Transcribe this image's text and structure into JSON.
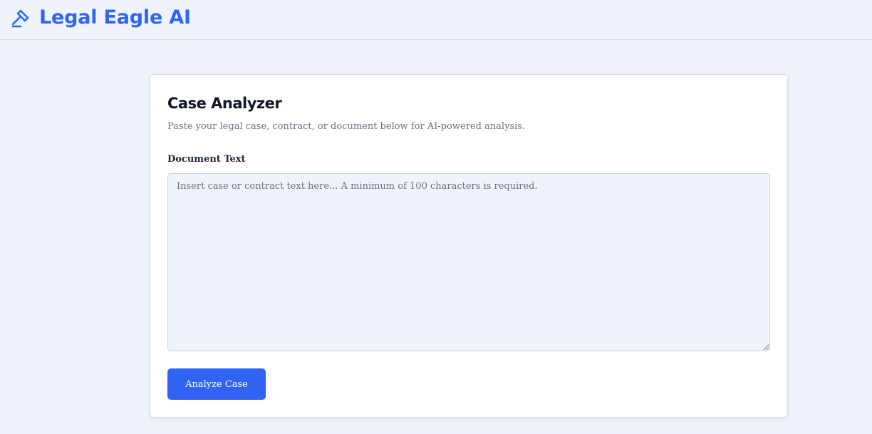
{
  "header": {
    "brand_title": "Legal Eagle AI",
    "brand_icon": "gavel-icon",
    "accent_color": "#2f66f2"
  },
  "analyzer": {
    "title": "Case Analyzer",
    "subtitle": "Paste your legal case, contract, or document below for AI-powered analysis.",
    "field_label": "Document Text",
    "textarea_value": "",
    "textarea_placeholder": "Insert case or contract text here... A minimum of 100 characters is required.",
    "submit_label": "Analyze Case",
    "button_color": "#3163f5"
  }
}
